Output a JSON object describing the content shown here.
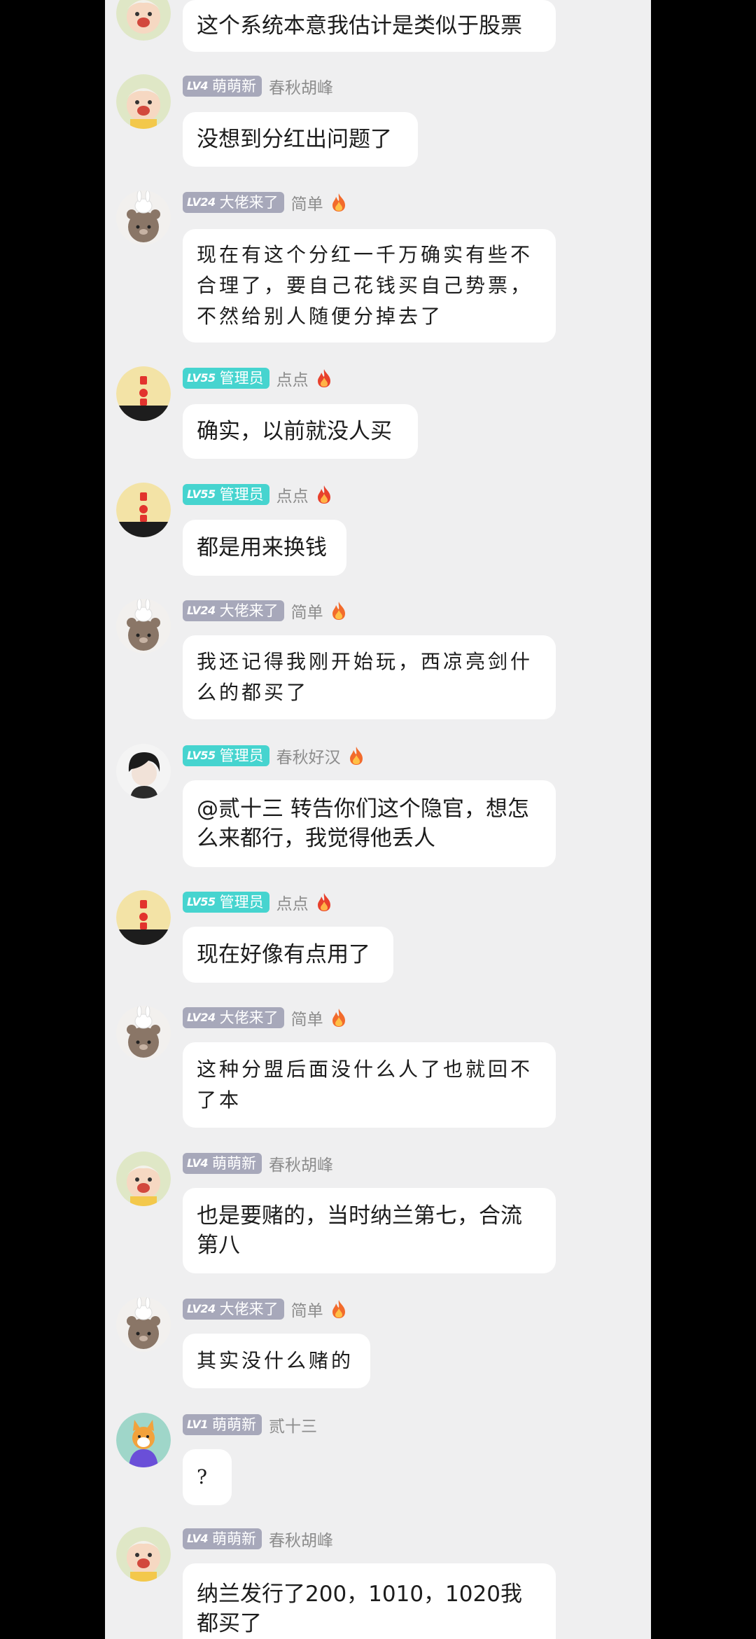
{
  "colors": {
    "background": "#efeff0",
    "bubble": "#ffffff",
    "username": "#8c8c8c",
    "badge_grey": "#a7a8ba",
    "badge_teal": "#46d4cf"
  },
  "messages": [
    {
      "text": "这个系统本意我估计是类似于股票",
      "avatar": "cartoon-girl-avatar"
    },
    {
      "level": "LV4",
      "title": "萌萌新",
      "username": "春秋胡峰",
      "flame": false,
      "text": "没想到分红出问题了",
      "avatar": "cartoon-girl-avatar",
      "badge_color": "#a7a8ba"
    },
    {
      "level": "LV24",
      "title": "大佬来了",
      "username": "简单",
      "flame": true,
      "text": "现在有这个分红一千万确实有些不合理了，要自己花钱买自己势票，不然给别人随便分掉去了",
      "avatar": "bear-bunny-avatar",
      "badge_color": "#a7a8ba"
    },
    {
      "level": "LV55",
      "title": "管理员",
      "username": "点点",
      "flame": true,
      "text": "确实，以前就没人买",
      "avatar": "lantern-avatar",
      "badge_color": "#46d4cf"
    },
    {
      "level": "LV55",
      "title": "管理员",
      "username": "点点",
      "flame": true,
      "text": "都是用来换钱",
      "avatar": "lantern-avatar",
      "badge_color": "#46d4cf"
    },
    {
      "level": "LV24",
      "title": "大佬来了",
      "username": "简单",
      "flame": true,
      "text": "我还记得我刚开始玩，西凉亮剑什么的都买了",
      "avatar": "bear-bunny-avatar",
      "badge_color": "#a7a8ba"
    },
    {
      "level": "LV55",
      "title": "管理员",
      "username": "春秋好汉",
      "flame": true,
      "text": "@贰十三 转告你们这个隐官，想怎么来都行，我觉得他丢人",
      "avatar": "dark-hair-boy-avatar",
      "badge_color": "#46d4cf"
    },
    {
      "level": "LV55",
      "title": "管理员",
      "username": "点点",
      "flame": true,
      "text": "现在好像有点用了",
      "avatar": "lantern-avatar",
      "badge_color": "#46d4cf"
    },
    {
      "level": "LV24",
      "title": "大佬来了",
      "username": "简单",
      "flame": true,
      "text": "这种分盟后面没什么人了也就回不了本",
      "avatar": "bear-bunny-avatar",
      "badge_color": "#a7a8ba"
    },
    {
      "level": "LV4",
      "title": "萌萌新",
      "username": "春秋胡峰",
      "flame": false,
      "text": "也是要赌的，当时纳兰第七，合流第八",
      "avatar": "cartoon-girl-avatar",
      "badge_color": "#a7a8ba"
    },
    {
      "level": "LV24",
      "title": "大佬来了",
      "username": "简单",
      "flame": true,
      "text": "其实没什么赌的",
      "avatar": "bear-bunny-avatar",
      "badge_color": "#a7a8ba"
    },
    {
      "level": "LV1",
      "title": "萌萌新",
      "username": "贰十三",
      "flame": false,
      "text": "?",
      "avatar": "fox-avatar",
      "badge_color": "#a7a8ba"
    },
    {
      "level": "LV4",
      "title": "萌萌新",
      "username": "春秋胡峰",
      "flame": false,
      "text": "纳兰发行了200，1010，1020我都买了",
      "avatar": "cartoon-girl-avatar",
      "badge_color": "#a7a8ba"
    }
  ]
}
